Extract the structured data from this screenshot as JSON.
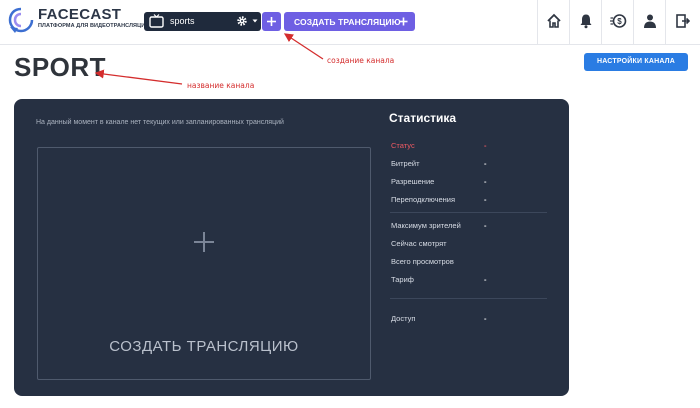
{
  "header": {
    "logo_name": "FACECAST",
    "logo_tagline": "ПЛАТФОРМА ДЛЯ ВИДЕОТРАНСЛЯЦИЙ",
    "channel_select_value": "sports",
    "create_broadcast_label": "СОЗДАТЬ ТРАНСЛЯЦИЮ",
    "icons": [
      "home-icon",
      "bell-icon",
      "money-icon",
      "user-icon",
      "exit-icon"
    ]
  },
  "page": {
    "title": "SPORT",
    "settings_button": "НАСТРОЙКИ КАНАЛА"
  },
  "annotations": {
    "create_channel": "создание канала",
    "channel_name": "название канала"
  },
  "panel": {
    "empty_message": "На данный момент в канале нет текущих или запланированных трансляций",
    "create_broadcast_label": "СОЗДАТЬ ТРАНСЛЯЦИЮ",
    "stats": {
      "title": "Статистика",
      "rows": [
        {
          "label": "Статус",
          "value": "-"
        },
        {
          "label": "Битрейт",
          "value": "-"
        },
        {
          "label": "Разрешение",
          "value": "-"
        },
        {
          "label": "Переподключения",
          "value": "-"
        },
        {
          "label": "Максимум зрителей",
          "value": "-"
        },
        {
          "label": "Сейчас смотрят",
          "value": ""
        },
        {
          "label": "Всего просмотров",
          "value": ""
        },
        {
          "label": "Тариф",
          "value": "-"
        },
        {
          "label": "Доступ",
          "value": "-"
        }
      ]
    }
  },
  "colors": {
    "accent_purple": "#6e5fe3",
    "panel_bg": "#263042",
    "settings_blue": "#2a7ce3",
    "status_red": "#ef5a63",
    "annotation_red": "#d42d2d"
  }
}
